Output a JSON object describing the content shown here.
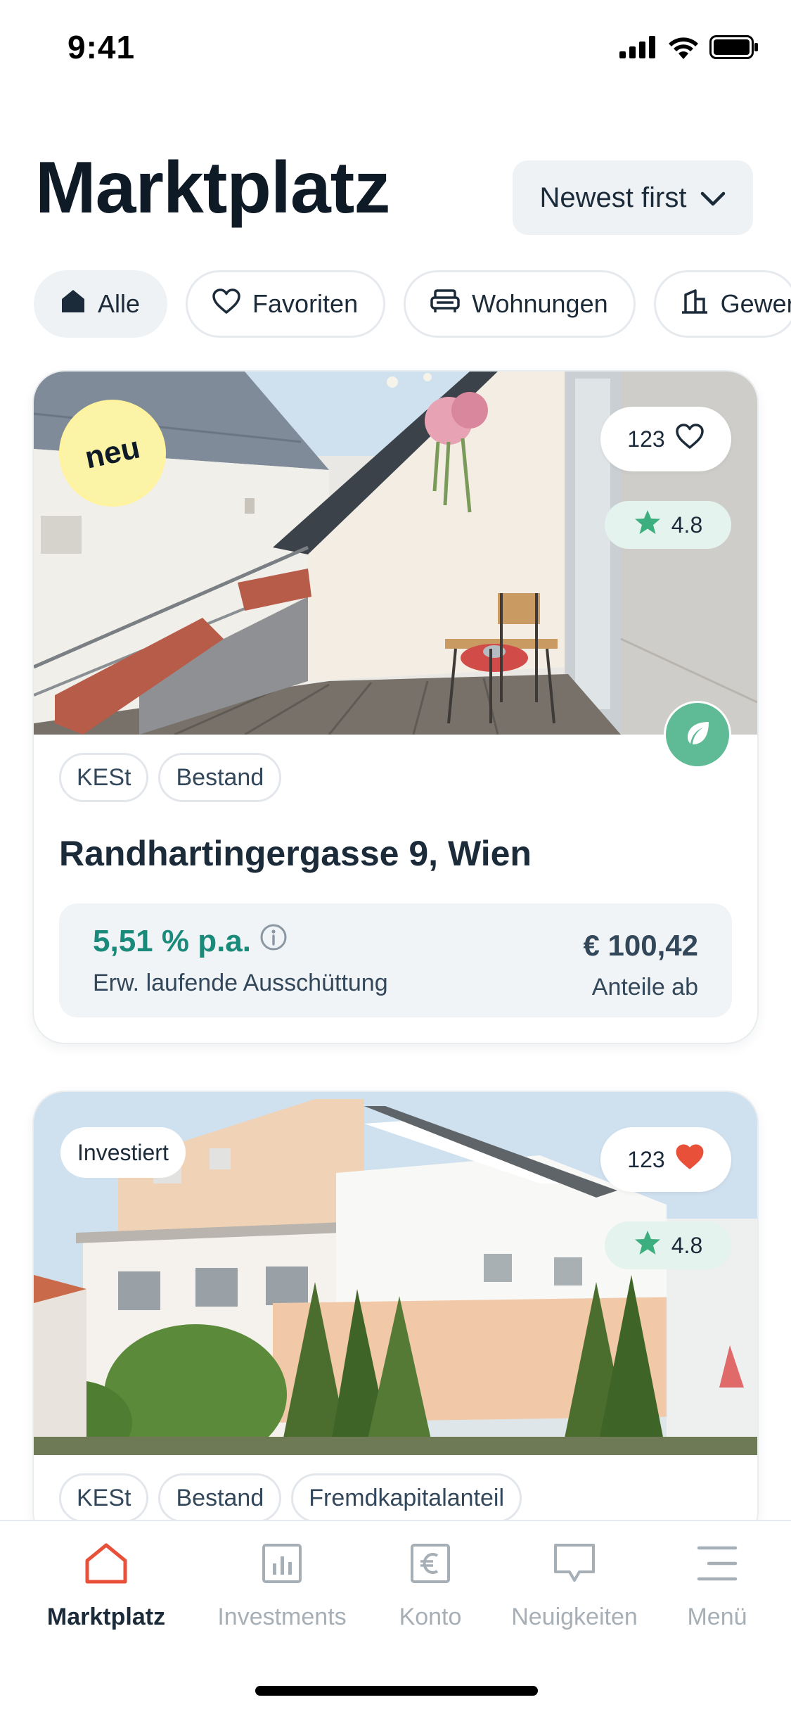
{
  "status_bar": {
    "time": "9:41",
    "signal_icon": "cellular-signal-icon",
    "wifi_icon": "wifi-icon",
    "battery_icon": "battery-icon"
  },
  "header": {
    "title": "Marktplatz",
    "sort": {
      "label": "Newest first",
      "icon": "chevron-down-icon"
    }
  },
  "filters": [
    {
      "label": "Alle",
      "icon": "house-icon",
      "active": true
    },
    {
      "label": "Favoriten",
      "icon": "heart-icon",
      "active": false
    },
    {
      "label": "Wohnungen",
      "icon": "sofa-icon",
      "active": false
    },
    {
      "label": "Gewer",
      "icon": "building-icon",
      "active": false
    }
  ],
  "listings": [
    {
      "badge": "neu",
      "likes": "123",
      "liked": false,
      "rating": "4.8",
      "eco": true,
      "tags": [
        "KESt",
        "Bestand"
      ],
      "title": "Randhartingergasse 9, Wien",
      "yield_value": "5,51 % p.a.",
      "yield_label": "Erw. laufende Ausschüttung",
      "price_value": "€ 100,42",
      "price_label": "Anteile ab"
    },
    {
      "badge": "Investiert",
      "likes": "123",
      "liked": true,
      "rating": "4.8",
      "tags": [
        "KESt",
        "Bestand",
        "Fremdkapitalanteil"
      ]
    }
  ],
  "tab_bar": [
    {
      "label": "Marktplatz",
      "icon": "home-icon",
      "active": true
    },
    {
      "label": "Investments",
      "icon": "bar-chart-icon",
      "active": false
    },
    {
      "label": "Konto",
      "icon": "euro-icon",
      "active": false
    },
    {
      "label": "Neuigkeiten",
      "icon": "chat-bubble-icon",
      "active": false
    },
    {
      "label": "Menü",
      "icon": "menu-icon",
      "active": false
    }
  ],
  "colors": {
    "accent_teal": "#1a8a7a",
    "eco_green": "#5fbb96",
    "heart_red": "#e8503a",
    "tab_active_icon": "#e8503a",
    "badge_yellow": "#fbf3a5"
  }
}
